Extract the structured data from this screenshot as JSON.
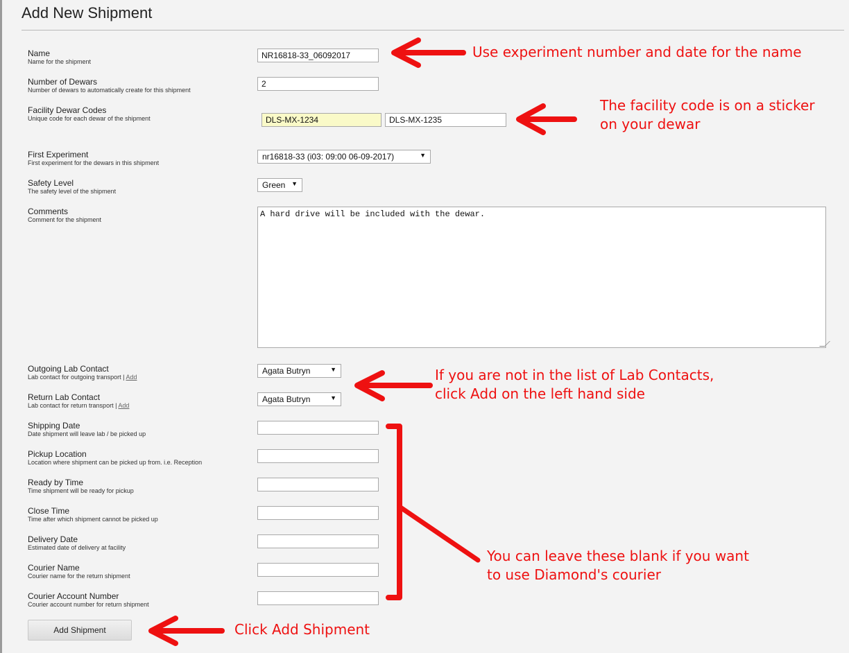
{
  "page": {
    "title": "Add New Shipment"
  },
  "form": {
    "name": {
      "label": "Name",
      "description": "Name for the shipment",
      "value": "NR16818-33_06092017"
    },
    "dewars": {
      "label": "Number of Dewars",
      "description": "Number of dewars to automatically create for this shipment",
      "value": "2"
    },
    "facility_codes": {
      "label": "Facility Dewar Codes",
      "description": "Unique code for each dewar of the shipment",
      "values": [
        "DLS-MX-1234",
        "DLS-MX-1235"
      ]
    },
    "first_experiment": {
      "label": "First Experiment",
      "description": "First experiment for the dewars in this shipment",
      "value": "nr16818-33 (i03: 09:00 06-09-2017)"
    },
    "safety_level": {
      "label": "Safety Level",
      "description": "The safety level of the shipment",
      "value": "Green"
    },
    "comments": {
      "label": "Comments",
      "description": "Comment for the shipment",
      "value": "A hard drive will be included with the dewar."
    },
    "outgoing_contact": {
      "label": "Outgoing Lab Contact",
      "description": "Lab contact for outgoing transport |",
      "link": "Add",
      "value": "Agata Butryn"
    },
    "return_contact": {
      "label": "Return Lab Contact",
      "description": "Lab contact for return transport |",
      "link": "Add",
      "value": "Agata Butryn"
    },
    "shipping_date": {
      "label": "Shipping Date",
      "description": "Date shipment will leave lab / be picked up",
      "value": ""
    },
    "pickup_location": {
      "label": "Pickup Location",
      "description": "Location where shipment can be picked up from. i.e. Reception",
      "value": ""
    },
    "ready_time": {
      "label": "Ready by Time",
      "description": "Time shipment will be ready for pickup",
      "value": ""
    },
    "close_time": {
      "label": "Close Time",
      "description": "Time after which shipment cannot be picked up",
      "value": ""
    },
    "delivery_date": {
      "label": "Delivery Date",
      "description": "Estimated date of delivery at facility",
      "value": ""
    },
    "courier_name": {
      "label": "Courier Name",
      "description": "Courier name for the return shipment",
      "value": ""
    },
    "courier_account": {
      "label": "Courier Account Number",
      "description": "Courier account number for return shipment",
      "value": ""
    },
    "submit_label": "Add Shipment"
  },
  "annotations": {
    "name_note": "Use experiment number and date for the name",
    "facility_note_1": "The facility code is on a sticker",
    "facility_note_2": "on your dewar",
    "contact_note_1": "If you are not in the list of Lab Contacts,",
    "contact_note_2": "click Add on the left hand side",
    "courier_note_1": "You can leave these blank if you want",
    "courier_note_2": "to use Diamond's courier",
    "add_note": "Click Add Shipment",
    "color": "#ee1111"
  },
  "colors": {
    "background": "#f3f3f3",
    "highlight_field": "#fafac8",
    "annotation": "#ee1111"
  }
}
